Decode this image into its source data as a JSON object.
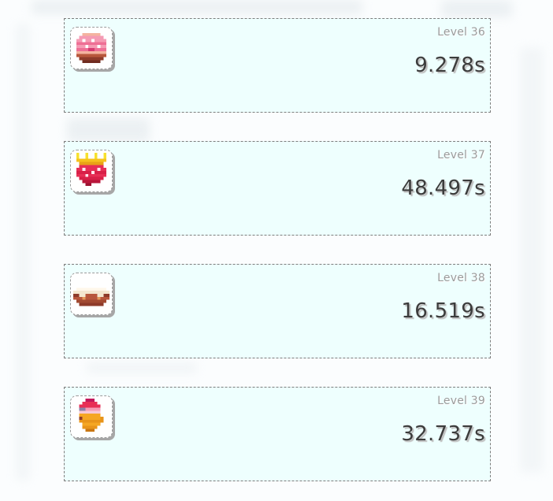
{
  "levels": [
    {
      "label": "Level 36",
      "time": "9.278s",
      "icon": "pink-donut-icon"
    },
    {
      "label": "Level 37",
      "time": "48.497s",
      "icon": "crowned-strawberry-icon"
    },
    {
      "label": "Level 38",
      "time": "16.519s",
      "icon": "cream-pie-icon"
    },
    {
      "label": "Level 39",
      "time": "32.737s",
      "icon": "sundae-cup-icon"
    }
  ],
  "colors": {
    "card_background": "#eefffe",
    "card_border": "#7d7d7d",
    "level_text": "#9b9b9b",
    "time_text": "#3c3c3c"
  }
}
